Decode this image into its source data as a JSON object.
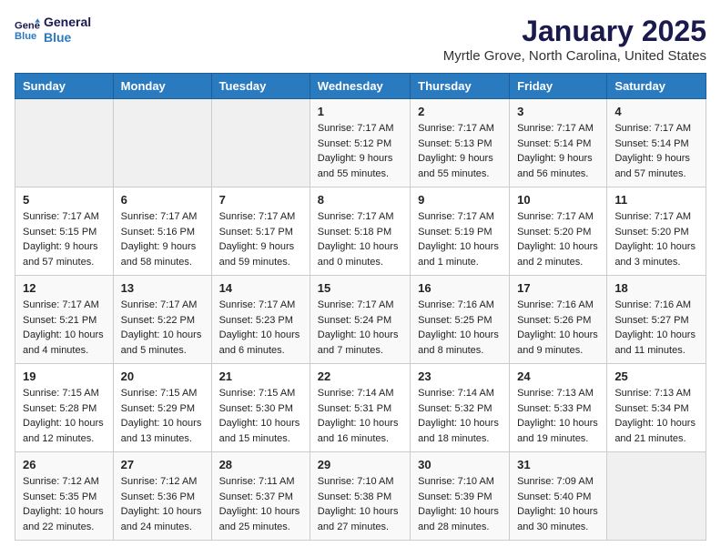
{
  "logo": {
    "line1": "General",
    "line2": "Blue"
  },
  "title": "January 2025",
  "subtitle": "Myrtle Grove, North Carolina, United States",
  "weekdays": [
    "Sunday",
    "Monday",
    "Tuesday",
    "Wednesday",
    "Thursday",
    "Friday",
    "Saturday"
  ],
  "weeks": [
    [
      {
        "day": "",
        "info": ""
      },
      {
        "day": "",
        "info": ""
      },
      {
        "day": "",
        "info": ""
      },
      {
        "day": "1",
        "info": "Sunrise: 7:17 AM\nSunset: 5:12 PM\nDaylight: 9 hours\nand 55 minutes."
      },
      {
        "day": "2",
        "info": "Sunrise: 7:17 AM\nSunset: 5:13 PM\nDaylight: 9 hours\nand 55 minutes."
      },
      {
        "day": "3",
        "info": "Sunrise: 7:17 AM\nSunset: 5:14 PM\nDaylight: 9 hours\nand 56 minutes."
      },
      {
        "day": "4",
        "info": "Sunrise: 7:17 AM\nSunset: 5:14 PM\nDaylight: 9 hours\nand 57 minutes."
      }
    ],
    [
      {
        "day": "5",
        "info": "Sunrise: 7:17 AM\nSunset: 5:15 PM\nDaylight: 9 hours\nand 57 minutes."
      },
      {
        "day": "6",
        "info": "Sunrise: 7:17 AM\nSunset: 5:16 PM\nDaylight: 9 hours\nand 58 minutes."
      },
      {
        "day": "7",
        "info": "Sunrise: 7:17 AM\nSunset: 5:17 PM\nDaylight: 9 hours\nand 59 minutes."
      },
      {
        "day": "8",
        "info": "Sunrise: 7:17 AM\nSunset: 5:18 PM\nDaylight: 10 hours\nand 0 minutes."
      },
      {
        "day": "9",
        "info": "Sunrise: 7:17 AM\nSunset: 5:19 PM\nDaylight: 10 hours\nand 1 minute."
      },
      {
        "day": "10",
        "info": "Sunrise: 7:17 AM\nSunset: 5:20 PM\nDaylight: 10 hours\nand 2 minutes."
      },
      {
        "day": "11",
        "info": "Sunrise: 7:17 AM\nSunset: 5:20 PM\nDaylight: 10 hours\nand 3 minutes."
      }
    ],
    [
      {
        "day": "12",
        "info": "Sunrise: 7:17 AM\nSunset: 5:21 PM\nDaylight: 10 hours\nand 4 minutes."
      },
      {
        "day": "13",
        "info": "Sunrise: 7:17 AM\nSunset: 5:22 PM\nDaylight: 10 hours\nand 5 minutes."
      },
      {
        "day": "14",
        "info": "Sunrise: 7:17 AM\nSunset: 5:23 PM\nDaylight: 10 hours\nand 6 minutes."
      },
      {
        "day": "15",
        "info": "Sunrise: 7:17 AM\nSunset: 5:24 PM\nDaylight: 10 hours\nand 7 minutes."
      },
      {
        "day": "16",
        "info": "Sunrise: 7:16 AM\nSunset: 5:25 PM\nDaylight: 10 hours\nand 8 minutes."
      },
      {
        "day": "17",
        "info": "Sunrise: 7:16 AM\nSunset: 5:26 PM\nDaylight: 10 hours\nand 9 minutes."
      },
      {
        "day": "18",
        "info": "Sunrise: 7:16 AM\nSunset: 5:27 PM\nDaylight: 10 hours\nand 11 minutes."
      }
    ],
    [
      {
        "day": "19",
        "info": "Sunrise: 7:15 AM\nSunset: 5:28 PM\nDaylight: 10 hours\nand 12 minutes."
      },
      {
        "day": "20",
        "info": "Sunrise: 7:15 AM\nSunset: 5:29 PM\nDaylight: 10 hours\nand 13 minutes."
      },
      {
        "day": "21",
        "info": "Sunrise: 7:15 AM\nSunset: 5:30 PM\nDaylight: 10 hours\nand 15 minutes."
      },
      {
        "day": "22",
        "info": "Sunrise: 7:14 AM\nSunset: 5:31 PM\nDaylight: 10 hours\nand 16 minutes."
      },
      {
        "day": "23",
        "info": "Sunrise: 7:14 AM\nSunset: 5:32 PM\nDaylight: 10 hours\nand 18 minutes."
      },
      {
        "day": "24",
        "info": "Sunrise: 7:13 AM\nSunset: 5:33 PM\nDaylight: 10 hours\nand 19 minutes."
      },
      {
        "day": "25",
        "info": "Sunrise: 7:13 AM\nSunset: 5:34 PM\nDaylight: 10 hours\nand 21 minutes."
      }
    ],
    [
      {
        "day": "26",
        "info": "Sunrise: 7:12 AM\nSunset: 5:35 PM\nDaylight: 10 hours\nand 22 minutes."
      },
      {
        "day": "27",
        "info": "Sunrise: 7:12 AM\nSunset: 5:36 PM\nDaylight: 10 hours\nand 24 minutes."
      },
      {
        "day": "28",
        "info": "Sunrise: 7:11 AM\nSunset: 5:37 PM\nDaylight: 10 hours\nand 25 minutes."
      },
      {
        "day": "29",
        "info": "Sunrise: 7:10 AM\nSunset: 5:38 PM\nDaylight: 10 hours\nand 27 minutes."
      },
      {
        "day": "30",
        "info": "Sunrise: 7:10 AM\nSunset: 5:39 PM\nDaylight: 10 hours\nand 28 minutes."
      },
      {
        "day": "31",
        "info": "Sunrise: 7:09 AM\nSunset: 5:40 PM\nDaylight: 10 hours\nand 30 minutes."
      },
      {
        "day": "",
        "info": ""
      }
    ]
  ]
}
